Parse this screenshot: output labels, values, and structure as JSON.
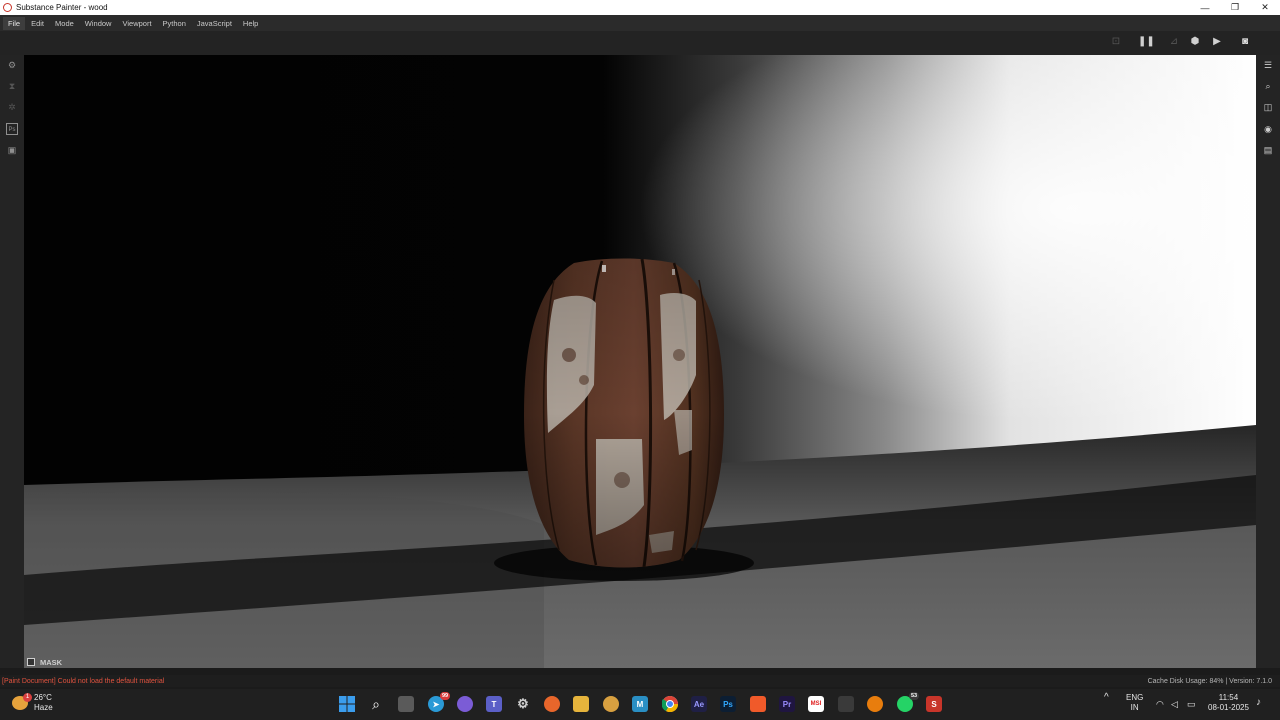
{
  "window": {
    "title": "Substance Painter - wood",
    "controls": {
      "minimize": "—",
      "restore": "❐",
      "close": "✕"
    }
  },
  "menu": {
    "items": [
      "File",
      "Edit",
      "Mode",
      "Window",
      "Viewport",
      "Python",
      "JavaScript",
      "Help"
    ],
    "active": "File"
  },
  "viewport": {
    "mask_label": "MASK"
  },
  "status": {
    "error": "[Paint Document] Could not load the default material",
    "right": "Cache Disk Usage:   84%  |  Version: 7.1.0"
  },
  "taskbar": {
    "weather": {
      "temp": "26°C",
      "condition": "Haze",
      "badge": "1"
    },
    "telegram_badge": "99",
    "whatsapp_badge": "53",
    "lang": "ENG",
    "region": "IN",
    "time": "11:54",
    "date": "08-01-2025"
  }
}
